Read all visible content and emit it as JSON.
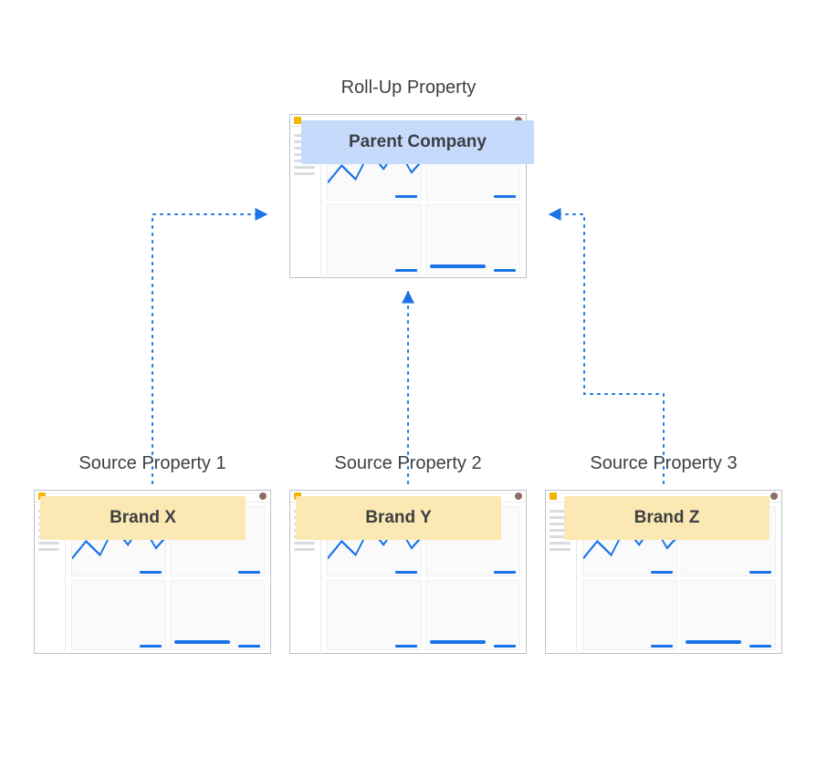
{
  "diagram": {
    "parent": {
      "title": "Roll-Up Property",
      "label": "Parent Company"
    },
    "children": [
      {
        "title": "Source Property 1",
        "label": "Brand  X"
      },
      {
        "title": "Source Property 2",
        "label": "Brand Y"
      },
      {
        "title": "Source Property 3",
        "label": "Brand Z"
      }
    ],
    "colors": {
      "connector": "#1a73e8",
      "parentPlate": "#c6dafc",
      "childPlate": "#fce8b2"
    }
  }
}
